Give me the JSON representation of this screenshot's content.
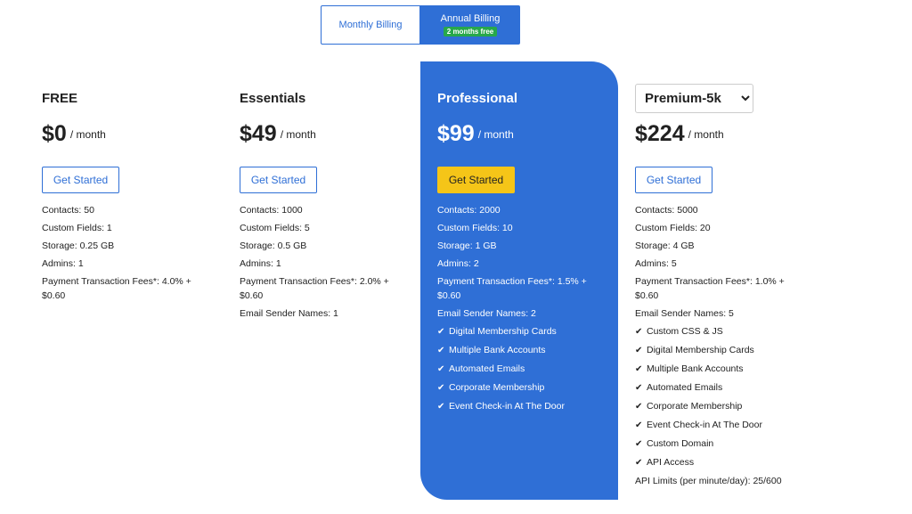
{
  "billing_toggle": {
    "monthly_label": "Monthly Billing",
    "annual_label": "Annual Billing",
    "annual_badge": "2 months free"
  },
  "plans": [
    {
      "name": "FREE",
      "price": "$0",
      "period": "/ month",
      "cta": "Get Started",
      "features": [
        "Contacts: 50",
        "Custom Fields: 1",
        "Storage: 0.25 GB",
        "Admins: 1",
        "Payment Transaction Fees*: 4.0% + $0.60"
      ],
      "checks": []
    },
    {
      "name": "Essentials",
      "price": "$49",
      "period": "/ month",
      "cta": "Get Started",
      "features": [
        "Contacts: 1000",
        "Custom Fields: 5",
        "Storage: 0.5 GB",
        "Admins: 1",
        "Payment Transaction Fees*: 2.0% + $0.60",
        "Email Sender Names: 1"
      ],
      "checks": []
    },
    {
      "name": "Professional",
      "price": "$99",
      "period": "/ month",
      "cta": "Get Started",
      "features": [
        "Contacts: 2000",
        "Custom Fields: 10",
        "Storage: 1 GB",
        "Admins: 2",
        "Payment Transaction Fees*: 1.5% + $0.60",
        "Email Sender Names: 2"
      ],
      "checks": [
        "Digital Membership Cards",
        "Multiple Bank Accounts",
        "Automated Emails",
        "Corporate Membership",
        "Event Check-in At The Door"
      ]
    },
    {
      "name": "Premium-5k",
      "price": "$224",
      "period": "/ month",
      "cta": "Get Started",
      "features": [
        "Contacts: 5000",
        "Custom Fields: 20",
        "Storage: 4 GB",
        "Admins: 5",
        "Payment Transaction Fees*: 1.0% + $0.60",
        "Email Sender Names: 5"
      ],
      "checks": [
        "Custom CSS & JS",
        "Digital Membership Cards",
        "Multiple Bank Accounts",
        "Automated Emails",
        "Corporate Membership",
        "Event Check-in At The Door",
        "Custom Domain",
        "API Access"
      ],
      "footer": "API Limits (per minute/day): 25/600"
    }
  ],
  "colors": {
    "accent": "#2f6fd6",
    "cta_highlight": "#f5c518",
    "badge_green": "#27a84a"
  }
}
